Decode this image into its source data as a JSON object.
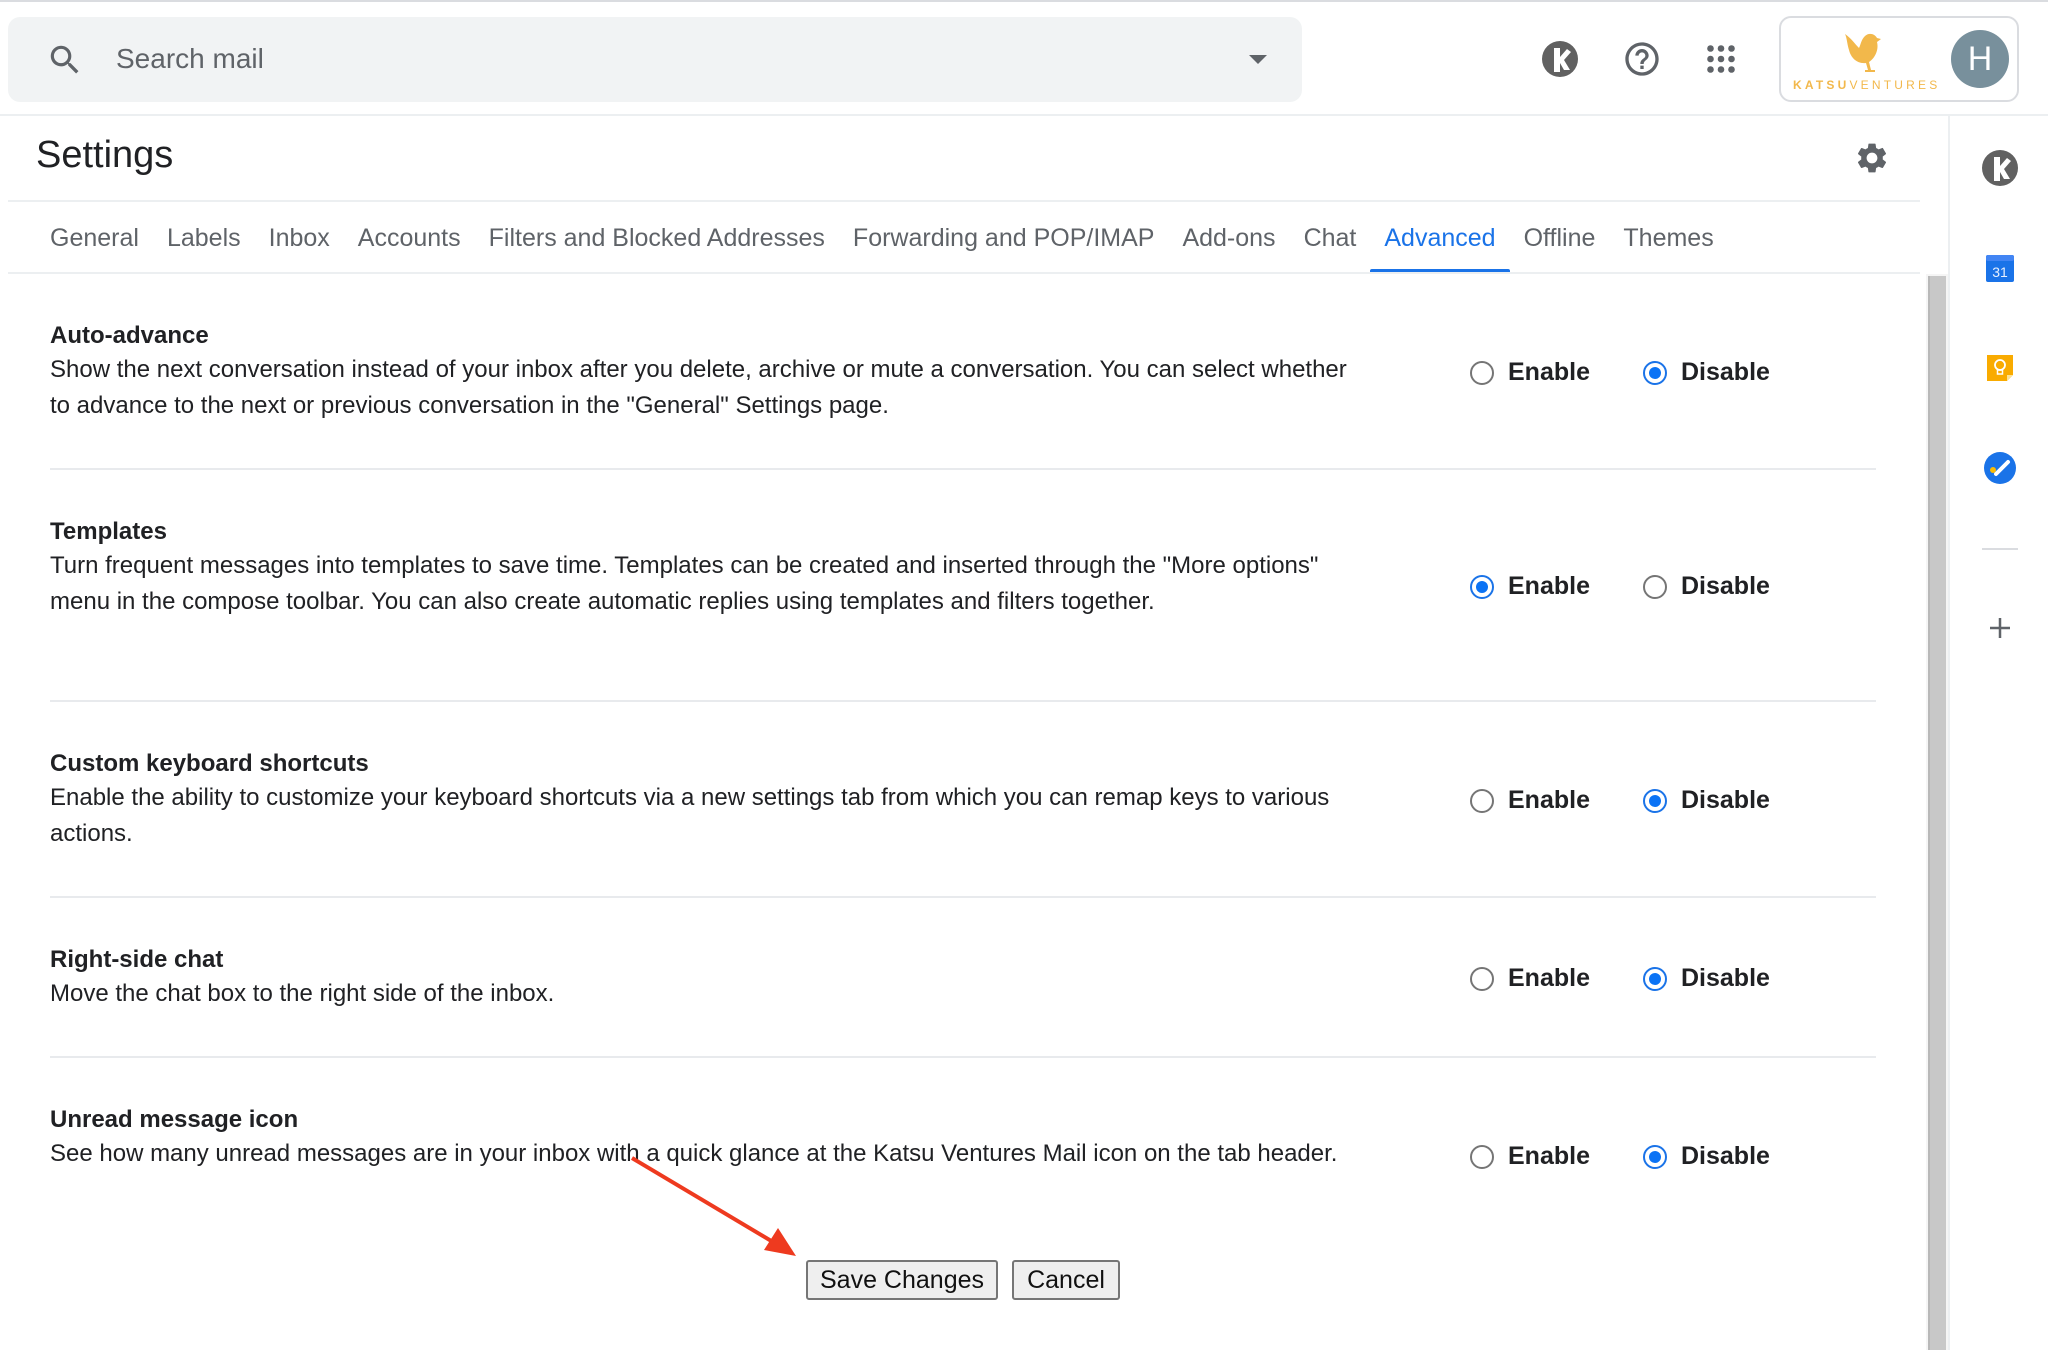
{
  "header": {
    "search": {
      "placeholder": "Search mail",
      "value": ""
    },
    "icons": {
      "search": "search-icon",
      "search_options": "caret-down-icon",
      "addon": "katsu-k-icon",
      "support": "help-icon",
      "apps": "apps-grid-icon"
    },
    "brand": {
      "name_bold": "KATSU",
      "name_light": "VENTURES"
    },
    "avatar_initial": "H"
  },
  "settings": {
    "title": "Settings",
    "tabs": [
      {
        "label": "General",
        "active": false
      },
      {
        "label": "Labels",
        "active": false
      },
      {
        "label": "Inbox",
        "active": false
      },
      {
        "label": "Accounts",
        "active": false
      },
      {
        "label": "Filters and Blocked Addresses",
        "active": false
      },
      {
        "label": "Forwarding and POP/IMAP",
        "active": false
      },
      {
        "label": "Add-ons",
        "active": false
      },
      {
        "label": "Chat",
        "active": false
      },
      {
        "label": "Advanced",
        "active": true
      },
      {
        "label": "Offline",
        "active": false
      },
      {
        "label": "Themes",
        "active": false
      }
    ],
    "items": [
      {
        "name": "Auto-advance",
        "description": "Show the next conversation instead of your inbox after you delete, archive or mute a conversation. You can select whether to advance to the next or previous conversation in the \"General\" Settings page.",
        "enable_label": "Enable",
        "disable_label": "Disable",
        "selected": "Disable"
      },
      {
        "name": "Templates",
        "description": "Turn frequent messages into templates to save time. Templates can be created and inserted through the \"More options\" menu in the compose toolbar. You can also create automatic replies using templates and filters together.",
        "enable_label": "Enable",
        "disable_label": "Disable",
        "selected": "Enable"
      },
      {
        "name": "Custom keyboard shortcuts",
        "description": "Enable the ability to customize your keyboard shortcuts via a new settings tab from which you can remap keys to various actions.",
        "enable_label": "Enable",
        "disable_label": "Disable",
        "selected": "Disable"
      },
      {
        "name": "Right-side chat",
        "description": "Move the chat box to the right side of the inbox.",
        "enable_label": "Enable",
        "disable_label": "Disable",
        "selected": "Disable"
      },
      {
        "name": "Unread message icon",
        "description": "See how many unread messages are in your inbox with a quick glance at the Katsu Ventures Mail icon on the tab header.",
        "enable_label": "Enable",
        "disable_label": "Disable",
        "selected": "Disable"
      }
    ],
    "buttons": {
      "save": "Save Changes",
      "cancel": "Cancel"
    }
  },
  "side_panel": {
    "items": [
      {
        "name": "katsu-k-icon"
      },
      {
        "name": "calendar-icon",
        "text": "31"
      },
      {
        "name": "keep-icon"
      },
      {
        "name": "tasks-icon"
      },
      {
        "name": "add-icon"
      }
    ]
  },
  "colors": {
    "accent": "#1a73e8",
    "radio_fill": "#0b73f5",
    "brand": "#f2b84b",
    "avatar": "#78909c",
    "annotation": "#ee3a1f"
  }
}
